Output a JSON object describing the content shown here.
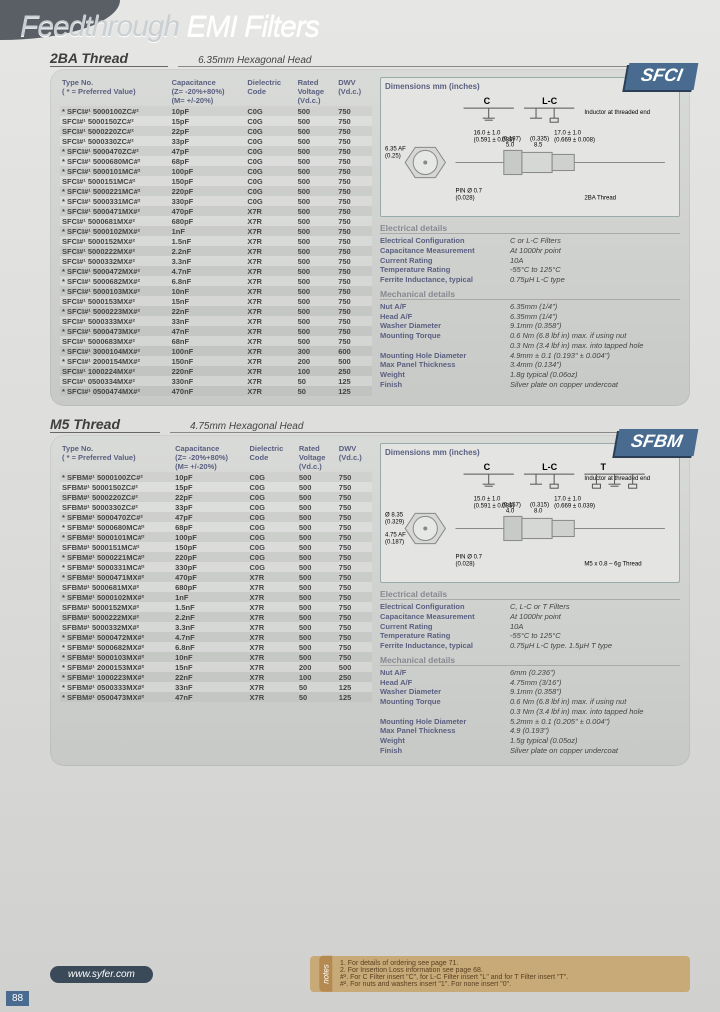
{
  "page": {
    "title_left": "Feedthrough",
    "title_right": "EMI Filters",
    "number": "88"
  },
  "sections": [
    {
      "thread": "2BA Thread",
      "subhead": "6.35mm Hexagonal Head",
      "badge": "SFCI",
      "prefix": "SFCI#¹",
      "headers": {
        "typeno": "Type No.",
        "typeno_sub": "( * = Preferred Value)",
        "cap": "Capacitance",
        "cap_sub": "(Z= -20%+80%)\n(M= +/-20%)",
        "diel": "Dielectric\nCode",
        "rv": "Rated\nVoltage\n(Vd.c.)",
        "dwv": "DWV\n(Vd.c.)"
      },
      "rows": [
        {
          "p": "*",
          "pn": "5000100ZC#²",
          "cap": "10pF",
          "d": "C0G",
          "rv": "500",
          "dwv": "750"
        },
        {
          "p": "",
          "pn": "5000150ZC#²",
          "cap": "15pF",
          "d": "C0G",
          "rv": "500",
          "dwv": "750"
        },
        {
          "p": "",
          "pn": "5000220ZC#²",
          "cap": "22pF",
          "d": "C0G",
          "rv": "500",
          "dwv": "750"
        },
        {
          "p": "",
          "pn": "5000330ZC#²",
          "cap": "33pF",
          "d": "C0G",
          "rv": "500",
          "dwv": "750"
        },
        {
          "p": "*",
          "pn": "5000470ZC#²",
          "cap": "47pF",
          "d": "C0G",
          "rv": "500",
          "dwv": "750"
        },
        {
          "p": "*",
          "pn": "5000680MC#²",
          "cap": "68pF",
          "d": "C0G",
          "rv": "500",
          "dwv": "750"
        },
        {
          "p": "*",
          "pn": "5000101MC#²",
          "cap": "100pF",
          "d": "C0G",
          "rv": "500",
          "dwv": "750"
        },
        {
          "p": "",
          "pn": "5000151MC#²",
          "cap": "150pF",
          "d": "C0G",
          "rv": "500",
          "dwv": "750"
        },
        {
          "p": "*",
          "pn": "5000221MC#²",
          "cap": "220pF",
          "d": "C0G",
          "rv": "500",
          "dwv": "750"
        },
        {
          "p": "*",
          "pn": "5000331MC#²",
          "cap": "330pF",
          "d": "C0G",
          "rv": "500",
          "dwv": "750"
        },
        {
          "p": "*",
          "pn": "5000471MX#²",
          "cap": "470pF",
          "d": "X7R",
          "rv": "500",
          "dwv": "750"
        },
        {
          "p": "",
          "pn": "5000681MX#²",
          "cap": "680pF",
          "d": "X7R",
          "rv": "500",
          "dwv": "750"
        },
        {
          "p": "*",
          "pn": "5000102MX#²",
          "cap": "1nF",
          "d": "X7R",
          "rv": "500",
          "dwv": "750"
        },
        {
          "p": "",
          "pn": "5000152MX#²",
          "cap": "1.5nF",
          "d": "X7R",
          "rv": "500",
          "dwv": "750"
        },
        {
          "p": "",
          "pn": "5000222MX#²",
          "cap": "2.2nF",
          "d": "X7R",
          "rv": "500",
          "dwv": "750"
        },
        {
          "p": "",
          "pn": "5000332MX#²",
          "cap": "3.3nF",
          "d": "X7R",
          "rv": "500",
          "dwv": "750"
        },
        {
          "p": "*",
          "pn": "5000472MX#²",
          "cap": "4.7nF",
          "d": "X7R",
          "rv": "500",
          "dwv": "750"
        },
        {
          "p": "*",
          "pn": "5000682MX#²",
          "cap": "6.8nF",
          "d": "X7R",
          "rv": "500",
          "dwv": "750"
        },
        {
          "p": "*",
          "pn": "5000103MX#²",
          "cap": "10nF",
          "d": "X7R",
          "rv": "500",
          "dwv": "750"
        },
        {
          "p": "",
          "pn": "5000153MX#²",
          "cap": "15nF",
          "d": "X7R",
          "rv": "500",
          "dwv": "750"
        },
        {
          "p": "*",
          "pn": "5000223MX#²",
          "cap": "22nF",
          "d": "X7R",
          "rv": "500",
          "dwv": "750"
        },
        {
          "p": "",
          "pn": "5000333MX#²",
          "cap": "33nF",
          "d": "X7R",
          "rv": "500",
          "dwv": "750"
        },
        {
          "p": "*",
          "pn": "5000473MX#²",
          "cap": "47nF",
          "d": "X7R",
          "rv": "500",
          "dwv": "750"
        },
        {
          "p": "",
          "pn": "5000683MX#²",
          "cap": "68nF",
          "d": "X7R",
          "rv": "500",
          "dwv": "750"
        },
        {
          "p": "*",
          "pn": "3000104MX#²",
          "cap": "100nF",
          "d": "X7R",
          "rv": "300",
          "dwv": "600"
        },
        {
          "p": "*",
          "pn": "2000154MX#²",
          "cap": "150nF",
          "d": "X7R",
          "rv": "200",
          "dwv": "500"
        },
        {
          "p": "",
          "pn": "1000224MX#²",
          "cap": "220nF",
          "d": "X7R",
          "rv": "100",
          "dwv": "250"
        },
        {
          "p": "",
          "pn": "0500334MX#²",
          "cap": "330nF",
          "d": "X7R",
          "rv": "50",
          "dwv": "125"
        },
        {
          "p": "*",
          "pn": "0500474MX#²",
          "cap": "470nF",
          "d": "X7R",
          "rv": "50",
          "dwv": "125"
        }
      ],
      "dimensions_label": "Dimensions mm (inches)",
      "dims": {
        "c_label": "C",
        "lc_label": "L-C",
        "ind_label": "Inductor at\nthreaded end",
        "af": "6.35 AF",
        "afin": "(0.25)",
        "c_len": "16.0 ± 1.0",
        "c_len_in": "(0.591 ± 0.039)",
        "lc_len": "17.0 ± 1.0",
        "lc_len_in": "(0.669 ± 0.008)",
        "h1": "5.0",
        "h1_in": "(0.197)",
        "h2": "8.5",
        "h2_in": "(0.335)",
        "pin": "PIN Ø 0.7",
        "pin_in": "(0.028)",
        "thread": "2BA Thread"
      },
      "electrical_title": "Electrical details",
      "electrical": [
        {
          "k": "Electrical Configuration",
          "v": "C or L-C Filters"
        },
        {
          "k": "Capacitance Measurement",
          "v": "At 1000hr point"
        },
        {
          "k": "Current Rating",
          "v": "10A"
        },
        {
          "k": "Temperature Rating",
          "v": "-55°C to 125°C"
        },
        {
          "k": "Ferrite Inductance, typical",
          "v": "0.75µH L-C type"
        }
      ],
      "mechanical_title": "Mechanical details",
      "mechanical": [
        {
          "k": "Nut A/F",
          "v": "6.35mm (1/4\")"
        },
        {
          "k": "Head A/F",
          "v": "6.35mm (1/4\")"
        },
        {
          "k": "Washer Diameter",
          "v": "9.1mm (0.358\")"
        },
        {
          "k": "Mounting Torque",
          "v": "0.6 Nm (6.8 lbf in) max. if using nut"
        },
        {
          "k": "",
          "v": "0.3 Nm (3.4 lbf in) max. into tapped hole"
        },
        {
          "k": "Mounting Hole Diameter",
          "v": "4.9mm ± 0.1 (0.193\" ± 0.004\")"
        },
        {
          "k": "Max Panel Thickness",
          "v": "3.4mm (0.134\")"
        },
        {
          "k": "Weight",
          "v": "1.8g typical (0.06oz)"
        },
        {
          "k": "Finish",
          "v": "Silver plate on copper undercoat"
        }
      ]
    },
    {
      "thread": "M5 Thread",
      "subhead": "4.75mm Hexagonal Head",
      "badge": "SFBM",
      "prefix": "SFBM#¹",
      "headers": {
        "typeno": "Type No.",
        "typeno_sub": "( * = Preferred Value)",
        "cap": "Capacitance",
        "cap_sub": "(Z= -20%+80%)\n(M= +/-20%)",
        "diel": "Dielectric\nCode",
        "rv": "Rated\nVoltage\n(Vd.c.)",
        "dwv": "DWV\n(Vd.c.)"
      },
      "rows": [
        {
          "p": "*",
          "pn": "5000100ZC#²",
          "cap": "10pF",
          "d": "C0G",
          "rv": "500",
          "dwv": "750"
        },
        {
          "p": "",
          "pn": "5000150ZC#²",
          "cap": "15pF",
          "d": "C0G",
          "rv": "500",
          "dwv": "750"
        },
        {
          "p": "",
          "pn": "5000220ZC#²",
          "cap": "22pF",
          "d": "C0G",
          "rv": "500",
          "dwv": "750"
        },
        {
          "p": "",
          "pn": "5000330ZC#²",
          "cap": "33pF",
          "d": "C0G",
          "rv": "500",
          "dwv": "750"
        },
        {
          "p": "*",
          "pn": "5000470ZC#²",
          "cap": "47pF",
          "d": "C0G",
          "rv": "500",
          "dwv": "750"
        },
        {
          "p": "*",
          "pn": "5000680MC#²",
          "cap": "68pF",
          "d": "C0G",
          "rv": "500",
          "dwv": "750"
        },
        {
          "p": "*",
          "pn": "5000101MC#²",
          "cap": "100pF",
          "d": "C0G",
          "rv": "500",
          "dwv": "750"
        },
        {
          "p": "",
          "pn": "5000151MC#²",
          "cap": "150pF",
          "d": "C0G",
          "rv": "500",
          "dwv": "750"
        },
        {
          "p": "*",
          "pn": "5000221MC#²",
          "cap": "220pF",
          "d": "C0G",
          "rv": "500",
          "dwv": "750"
        },
        {
          "p": "*",
          "pn": "5000331MC#²",
          "cap": "330pF",
          "d": "C0G",
          "rv": "500",
          "dwv": "750"
        },
        {
          "p": "*",
          "pn": "5000471MX#²",
          "cap": "470pF",
          "d": "X7R",
          "rv": "500",
          "dwv": "750"
        },
        {
          "p": "",
          "pn": "5000681MX#²",
          "cap": "680pF",
          "d": "X7R",
          "rv": "500",
          "dwv": "750"
        },
        {
          "p": "*",
          "pn": "5000102MX#²",
          "cap": "1nF",
          "d": "X7R",
          "rv": "500",
          "dwv": "750"
        },
        {
          "p": "",
          "pn": "5000152MX#²",
          "cap": "1.5nF",
          "d": "X7R",
          "rv": "500",
          "dwv": "750"
        },
        {
          "p": "",
          "pn": "5000222MX#²",
          "cap": "2.2nF",
          "d": "X7R",
          "rv": "500",
          "dwv": "750"
        },
        {
          "p": "",
          "pn": "5000332MX#²",
          "cap": "3.3nF",
          "d": "X7R",
          "rv": "500",
          "dwv": "750"
        },
        {
          "p": "*",
          "pn": "5000472MX#²",
          "cap": "4.7nF",
          "d": "X7R",
          "rv": "500",
          "dwv": "750"
        },
        {
          "p": "*",
          "pn": "5000682MX#²",
          "cap": "6.8nF",
          "d": "X7R",
          "rv": "500",
          "dwv": "750"
        },
        {
          "p": "*",
          "pn": "5000103MX#²",
          "cap": "10nF",
          "d": "X7R",
          "rv": "500",
          "dwv": "750"
        },
        {
          "p": "*",
          "pn": "2000153MX#²",
          "cap": "15nF",
          "d": "X7R",
          "rv": "200",
          "dwv": "500"
        },
        {
          "p": "*",
          "pn": "1000223MX#²",
          "cap": "22nF",
          "d": "X7R",
          "rv": "100",
          "dwv": "250"
        },
        {
          "p": "*",
          "pn": "0500333MX#²",
          "cap": "33nF",
          "d": "X7R",
          "rv": "50",
          "dwv": "125"
        },
        {
          "p": "*",
          "pn": "0500473MX#²",
          "cap": "47nF",
          "d": "X7R",
          "rv": "50",
          "dwv": "125"
        }
      ],
      "dimensions_label": "Dimensions mm (inches)",
      "dims": {
        "c_label": "C",
        "lc_label": "L-C",
        "ind_label": "Inductor at\nthreaded end",
        "t_label": "T",
        "af": "Ø 8.35",
        "afin": "(0.329)",
        "af2": "4.75 AF",
        "af2_in": "(0.187)",
        "c_len": "15.0 ± 1.0",
        "c_len_in": "(0.591 ± 0.039)",
        "lc_len": "17.0 ± 1.0",
        "lc_len_in": "(0.669 ± 0.039)",
        "h1": "4.0",
        "h1_in": "(0.157)",
        "h2": "8.0",
        "h2_in": "(0.315)",
        "pin": "PIN Ø 0.7",
        "pin_in": "(0.028)",
        "thread": "M5 x 0.8 – 6g Thread"
      },
      "electrical_title": "Electrical details",
      "electrical": [
        {
          "k": "Electrical Configuration",
          "v": "C, L-C or T Filters"
        },
        {
          "k": "Capacitance Measurement",
          "v": "At 1000hr point"
        },
        {
          "k": "Current Rating",
          "v": "10A"
        },
        {
          "k": "Temperature Rating",
          "v": "-55°C to 125°C"
        },
        {
          "k": "Ferrite Inductance, typical",
          "v": "0.75µH L-C type. 1.5µH T type"
        }
      ],
      "mechanical_title": "Mechanical details",
      "mechanical": [
        {
          "k": "Nut A/F",
          "v": "6mm (0.236\")"
        },
        {
          "k": "Head A/F",
          "v": "4.75mm (3/16\")"
        },
        {
          "k": "Washer Diameter",
          "v": "9.1mm (0.358\")"
        },
        {
          "k": "Mounting Torque",
          "v": "0.6 Nm (6.8 lbf in) max. if using nut"
        },
        {
          "k": "",
          "v": "0.3 Nm (3.4 lbf in) max. into tapped hole"
        },
        {
          "k": "Mounting Hole Diameter",
          "v": "5.2mm ± 0.1 (0.205\" ± 0.004\")"
        },
        {
          "k": "Max Panel Thickness",
          "v": "4.9 (0.193\")"
        },
        {
          "k": "Weight",
          "v": "1.5g typical (0.05oz)"
        },
        {
          "k": "Finish",
          "v": "Silver plate on copper undercoat"
        }
      ]
    }
  ],
  "footer": {
    "logo": "www.syfer.com",
    "notes_tab": "notes",
    "notes": [
      "1. For details of ordering see page 71.",
      "2. For Insertion Loss information see page 68.",
      "#³. For C Filter insert \"C\", for L-C Filter insert \"L\" and for T Filter insert \"T\".",
      "#². For nuts and washers insert \"1\". For none insert \"0\"."
    ]
  }
}
